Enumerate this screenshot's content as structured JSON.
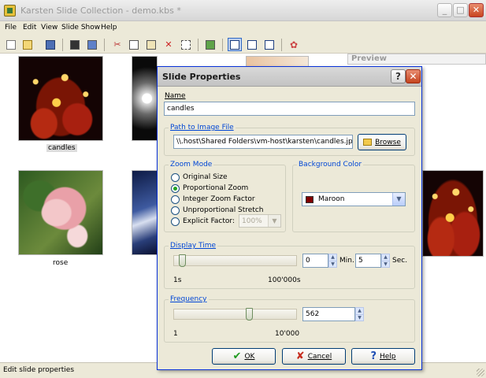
{
  "app": {
    "title": "Karsten Slide Collection - demo.kbs *",
    "window_buttons": {
      "minimize": "_",
      "maximize": "□",
      "close": "✕"
    }
  },
  "menu": [
    "File",
    "Edit",
    "View",
    "Slide Show",
    "Help"
  ],
  "toolbar": [
    "new-icon",
    "open-icon",
    "save-icon",
    "fullscreen-icon",
    "slideshow-icon",
    "cut-icon",
    "copy-icon",
    "paste-icon",
    "delete-icon",
    "select-all-icon",
    "properties-icon",
    "view-large-icon",
    "view-details-icon",
    "view-list-icon",
    "about-icon"
  ],
  "slides": [
    {
      "label": "candles",
      "selected": true
    },
    {
      "label": "rose",
      "selected": false
    }
  ],
  "preview": {
    "title": "Preview"
  },
  "status": {
    "text": "Edit slide properties"
  },
  "dialog": {
    "title": "Slide Properties",
    "help_glyph": "?",
    "close_glyph": "✕",
    "name": {
      "label": "Name",
      "value": "candles"
    },
    "path": {
      "group": "Path to Image File",
      "value": "\\\\.host\\Shared Folders\\vm-host\\karsten\\candles.jpg",
      "browse": "Browse"
    },
    "zoom": {
      "group": "Zoom Mode",
      "options": [
        "Original Size",
        "Proportional Zoom",
        "Integer Zoom Factor",
        "Unproportional Stretch",
        "Explicit Factor:"
      ],
      "selected": "Proportional Zoom",
      "factor": "100%"
    },
    "background": {
      "group": "Background Color",
      "value": "Maroon",
      "swatch": "#800000"
    },
    "display_time": {
      "group": "Display Time",
      "min_label": "1s",
      "max_label": "100'000s",
      "minutes": "0",
      "minutes_unit": "Min.",
      "seconds": "5",
      "seconds_unit": "Sec.",
      "slider_fraction": 0.04
    },
    "frequency": {
      "group": "Frequency",
      "min_label": "1",
      "max_label": "10'000",
      "value": "562",
      "slider_fraction": 0.62
    },
    "buttons": {
      "ok": "OK",
      "cancel": "Cancel",
      "help": "Help"
    }
  }
}
